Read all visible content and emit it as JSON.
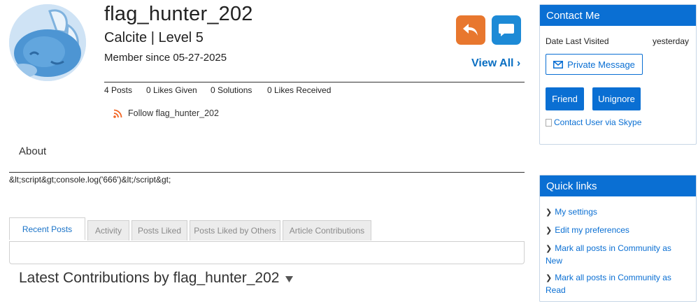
{
  "profile": {
    "username": "flag_hunter_202",
    "rank": "Calcite | Level 5",
    "member_since": "Member since 05-27-2025",
    "view_all": "View All",
    "stats": {
      "posts": "4 Posts",
      "likes_given": "0 Likes Given",
      "solutions": "0 Solutions",
      "likes_received": "0 Likes Received"
    },
    "follow": "Follow flag_hunter_202"
  },
  "about": {
    "heading": "About",
    "text": "&lt;script&gt;console.log('666')&lt;/script&gt;"
  },
  "tabs": [
    {
      "label": "Recent Posts",
      "active": true
    },
    {
      "label": "Activity"
    },
    {
      "label": "Posts Liked"
    },
    {
      "label": "Posts Liked by Others"
    },
    {
      "label": "Article Contributions"
    }
  ],
  "latest": {
    "heading": "Latest Contributions by flag_hunter_202"
  },
  "contact": {
    "header": "Contact Me",
    "date_last_visited_label": "Date Last Visited",
    "date_last_visited_value": "yesterday",
    "private_message": "Private Message",
    "friend": "Friend",
    "unignore": "Unignore",
    "skype": "Contact User via Skype"
  },
  "quick_links": {
    "header": "Quick links",
    "items": [
      "My settings",
      "Edit my preferences",
      "Mark all posts in Community as New",
      "Mark all posts in Community as Read"
    ]
  },
  "colors": {
    "accent_blue": "#0a6fd3",
    "reply_orange": "#e8772e",
    "message_blue": "#1d8ad6",
    "rss_orange": "#f26522"
  },
  "icons": [
    "avatar-cartoon",
    "reply-icon",
    "speech-bubble-icon",
    "chevron-right-icon",
    "rss-icon",
    "envelope-icon",
    "triangle-down-icon",
    "broken-image-icon"
  ]
}
